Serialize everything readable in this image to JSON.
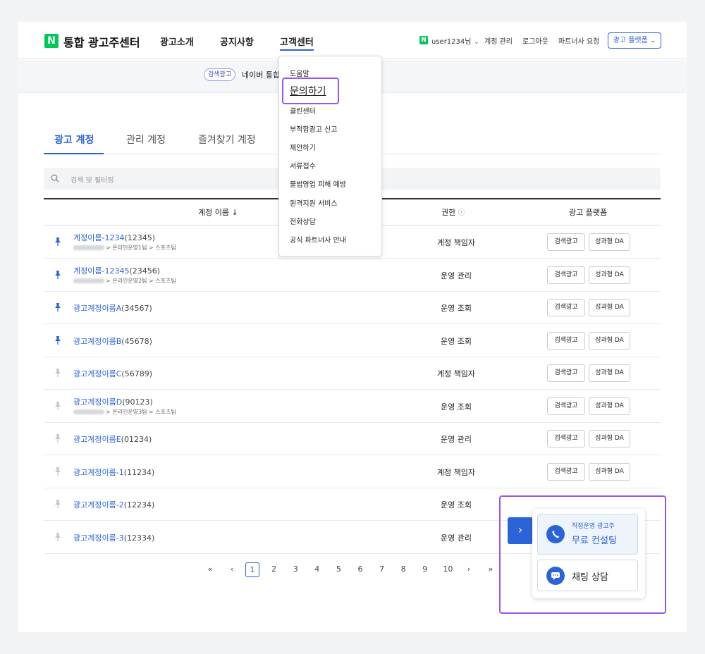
{
  "header": {
    "logo": "N",
    "brand": "통합 광고주센터",
    "nav": [
      "광고소개",
      "공지사항",
      "고객센터"
    ],
    "user": "user1234님",
    "util": [
      "계정 관리",
      "로그아웃",
      "파트너사 요청"
    ],
    "platform_button": "광고 플랫폼"
  },
  "banner": {
    "tag": "검색광고",
    "text": "네이버 통합"
  },
  "dropdown": {
    "items": [
      "도움말",
      "문의하기",
      "클린센터",
      "부적합광고 신고",
      "제안하기",
      "서류접수",
      "불법영업 피해 예방",
      "원격지원 서비스",
      "전화상담",
      "공식 파트너사 안내"
    ]
  },
  "tabs": [
    "광고 계정",
    "관리 계정",
    "즐겨찾기 계정"
  ],
  "search": {
    "placeholder": "검색 및 필터링"
  },
  "table": {
    "headers": {
      "name": "계정 이름 ↓",
      "role": "권한",
      "platform": "광고 플랫폼"
    },
    "platform_buttons": [
      "검색광고",
      "성과형 DA"
    ],
    "rows": [
      {
        "name": "계정이름-1234",
        "num": "(12345)",
        "path": "> 온라인운영1팀 > 스포츠팀",
        "role": "계정 책임자",
        "pinned": true,
        "has_buttons": true
      },
      {
        "name": "계정이름-12345",
        "num": "(23456)",
        "path": "> 온라인운영2팀 > 스포츠팀",
        "role": "운영 관리",
        "pinned": true,
        "has_buttons": true
      },
      {
        "name": "광고계정이름A",
        "num": "(34567)",
        "path": "",
        "role": "운영 조회",
        "pinned": true,
        "has_buttons": true
      },
      {
        "name": "광고계정이름B",
        "num": "(45678)",
        "path": "",
        "role": "운영 조회",
        "pinned": true,
        "has_buttons": true
      },
      {
        "name": "광고계정이름C",
        "num": "(56789)",
        "path": "",
        "role": "계정 책임자",
        "pinned": false,
        "has_buttons": true
      },
      {
        "name": "광고계정이름D",
        "num": "(90123)",
        "path": "> 온라인운영3팀 > 스포츠팀",
        "role": "운영 조회",
        "pinned": false,
        "has_buttons": true
      },
      {
        "name": "광고계정이름E",
        "num": "(01234)",
        "path": "",
        "role": "운영 관리",
        "pinned": false,
        "has_buttons": true
      },
      {
        "name": "광고계정이름-1",
        "num": "(11234)",
        "path": "",
        "role": "계정 책임자",
        "pinned": false,
        "has_buttons": true
      },
      {
        "name": "광고계정이름-2",
        "num": "(12234)",
        "path": "",
        "role": "운영 조회",
        "pinned": false,
        "has_buttons": false
      },
      {
        "name": "광고계정이름-3",
        "num": "(12334)",
        "path": "",
        "role": "운영 관리",
        "pinned": false,
        "has_buttons": false
      }
    ]
  },
  "pagination": {
    "first": "«",
    "prev": "‹",
    "pages": [
      "1",
      "2",
      "3",
      "4",
      "5",
      "6",
      "7",
      "8",
      "9",
      "10"
    ],
    "current": "1",
    "next": "›",
    "last": "»"
  },
  "float": {
    "arrow": "›",
    "consult_sub": "직접운영 광고주",
    "consult_main": "무료 컨설팅",
    "chat": "채팅 상담"
  },
  "colors": {
    "accent": "#2b63d9",
    "brand": "#03c75a",
    "highlight": "#9b55e8"
  }
}
